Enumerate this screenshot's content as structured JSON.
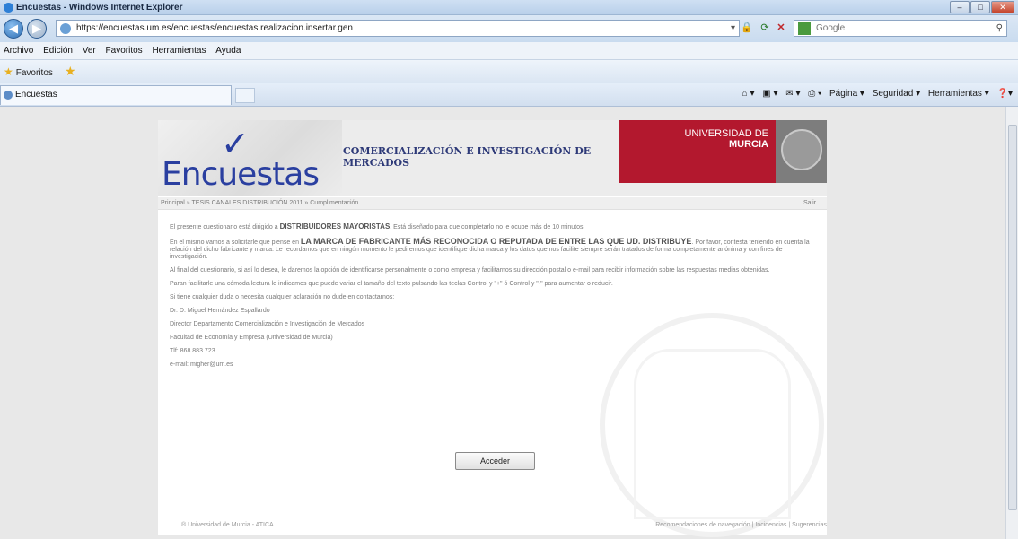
{
  "window": {
    "title": "Encuestas - Windows Internet Explorer"
  },
  "address": {
    "url": "https://encuestas.um.es/encuestas/encuestas.realizacion.insertar.gen"
  },
  "search": {
    "placeholder": "Google"
  },
  "menu": [
    "Archivo",
    "Edición",
    "Ver",
    "Favoritos",
    "Herramientas",
    "Ayuda"
  ],
  "favorites": {
    "label": "Favoritos"
  },
  "tab": {
    "label": "Encuestas"
  },
  "commandbar": {
    "page": "Página ▾",
    "security": "Seguridad ▾",
    "tools": "Herramientas ▾"
  },
  "header": {
    "logo": "Encuestas",
    "title": "COMERCIALIZACIÓN E INVESTIGACIÓN DE MERCADOS",
    "university_line1": "UNIVERSIDAD DE",
    "university_line2": "MURCIA"
  },
  "breadcrumb": {
    "text": "Principal » TESIS CANALES DISTRIBUCIÓN 2011 » Cumplimentación",
    "exit": "Salir"
  },
  "content": {
    "p1_a": "El presente cuestionario está dirigido a",
    "p1_b": "DISTRIBUIDORES MAYORISTAS",
    "p1_c": ". Está diseñado para que completarlo no le ocupe más de 10 minutos.",
    "p2_a": "En el mismo vamos a solicitarle que piense en",
    "p2_b": "LA MARCA DE FABRICANTE MÁS RECONOCIDA O REPUTADA DE ENTRE LAS QUE UD. DISTRIBUYE",
    "p2_c": ". Por favor, contesta teniendo en cuenta la relación del dicho fabricante y marca. Le recordamos que en ningún momento le pediremos que identifique dicha marca y los datos que nos facilite siempre serán tratados de forma completamente anónima y con fines de investigación.",
    "p3": "Al final del cuestionario, si así lo desea, le daremos la opción de identificarse personalmente o como empresa y facilitarnos su dirección postal o e-mail para recibir información sobre las respuestas medias obtenidas.",
    "p4": "Paran facilitarle una cómoda lectura le indicamos que puede variar el tamaño del texto pulsando las teclas Control y \"+\" ó Control y \"-\" para aumentar o reducir.",
    "p5": "Si tiene cualquier duda o necesita cualquier aclaración no dude en contactarnos:",
    "p6": "Dr. D. Miguel Hernández Espallardo",
    "p7": "Director Departamento Comercialización e Investigación de Mercados",
    "p8": "Facultad de Economía y Empresa (Universidad de Murcia)",
    "p9": "Tlf: 868 883 723",
    "p10": "e-mail: migher@um.es"
  },
  "button": {
    "label": "Acceder"
  },
  "footer": {
    "left": "® Universidad de Murcia - ATICA",
    "right": "Recomendaciones de navegación | Incidencias | Sugerencias"
  }
}
